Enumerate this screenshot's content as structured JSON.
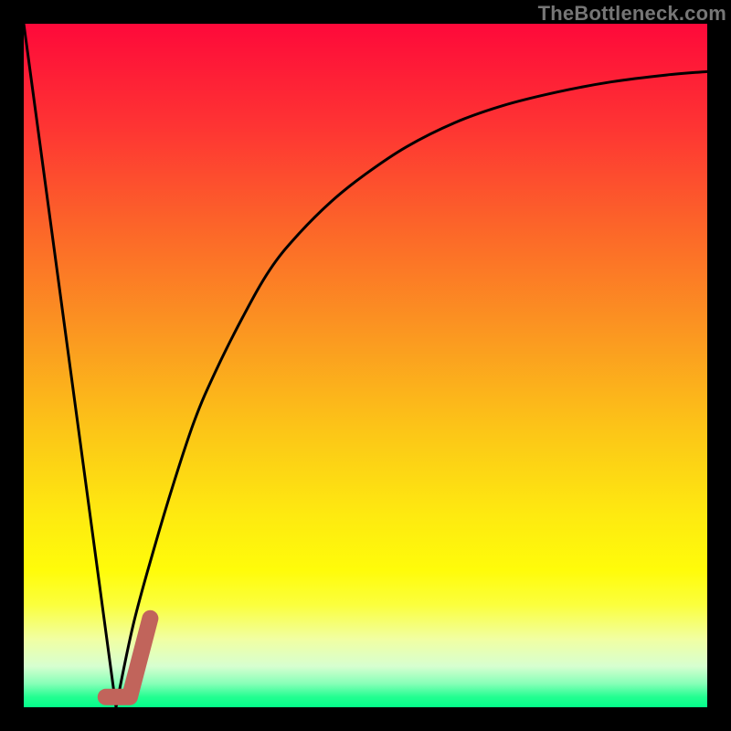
{
  "watermark": "TheBottleneck.com",
  "colors": {
    "frame": "#000000",
    "watermark": "#767676",
    "curve": "#000000",
    "marker": "#c1645b",
    "gradient_stops": [
      {
        "offset": 0.0,
        "color": "#fe093a"
      },
      {
        "offset": 0.15,
        "color": "#fe3433"
      },
      {
        "offset": 0.3,
        "color": "#fc6629"
      },
      {
        "offset": 0.45,
        "color": "#fb9621"
      },
      {
        "offset": 0.6,
        "color": "#fcc717"
      },
      {
        "offset": 0.72,
        "color": "#feea10"
      },
      {
        "offset": 0.8,
        "color": "#fffc0a"
      },
      {
        "offset": 0.85,
        "color": "#fbff3d"
      },
      {
        "offset": 0.9,
        "color": "#f1ffa2"
      },
      {
        "offset": 0.94,
        "color": "#d7ffd0"
      },
      {
        "offset": 0.965,
        "color": "#88ffb8"
      },
      {
        "offset": 0.985,
        "color": "#23fe91"
      },
      {
        "offset": 1.0,
        "color": "#03fd8a"
      }
    ]
  },
  "chart_data": {
    "type": "line",
    "title": "",
    "xlabel": "",
    "ylabel": "",
    "xlim": [
      0,
      100
    ],
    "ylim": [
      0,
      100
    ],
    "grid": false,
    "series": [
      {
        "name": "left-segment",
        "x": [
          0,
          13.5
        ],
        "y": [
          100,
          0
        ]
      },
      {
        "name": "right-curve",
        "x": [
          13.5,
          16,
          19,
          22,
          25,
          28,
          32,
          36,
          40,
          45,
          50,
          56,
          63,
          70,
          78,
          86,
          94,
          100
        ],
        "y": [
          0,
          12,
          23,
          33,
          42,
          49,
          57,
          64,
          69,
          74,
          78,
          82,
          85.5,
          88,
          90,
          91.5,
          92.5,
          93
        ]
      }
    ],
    "marker": {
      "name": "j-marker",
      "points": [
        {
          "x": 12.0,
          "y": 1.5
        },
        {
          "x": 15.5,
          "y": 1.5
        },
        {
          "x": 18.5,
          "y": 13.0
        }
      ]
    }
  }
}
